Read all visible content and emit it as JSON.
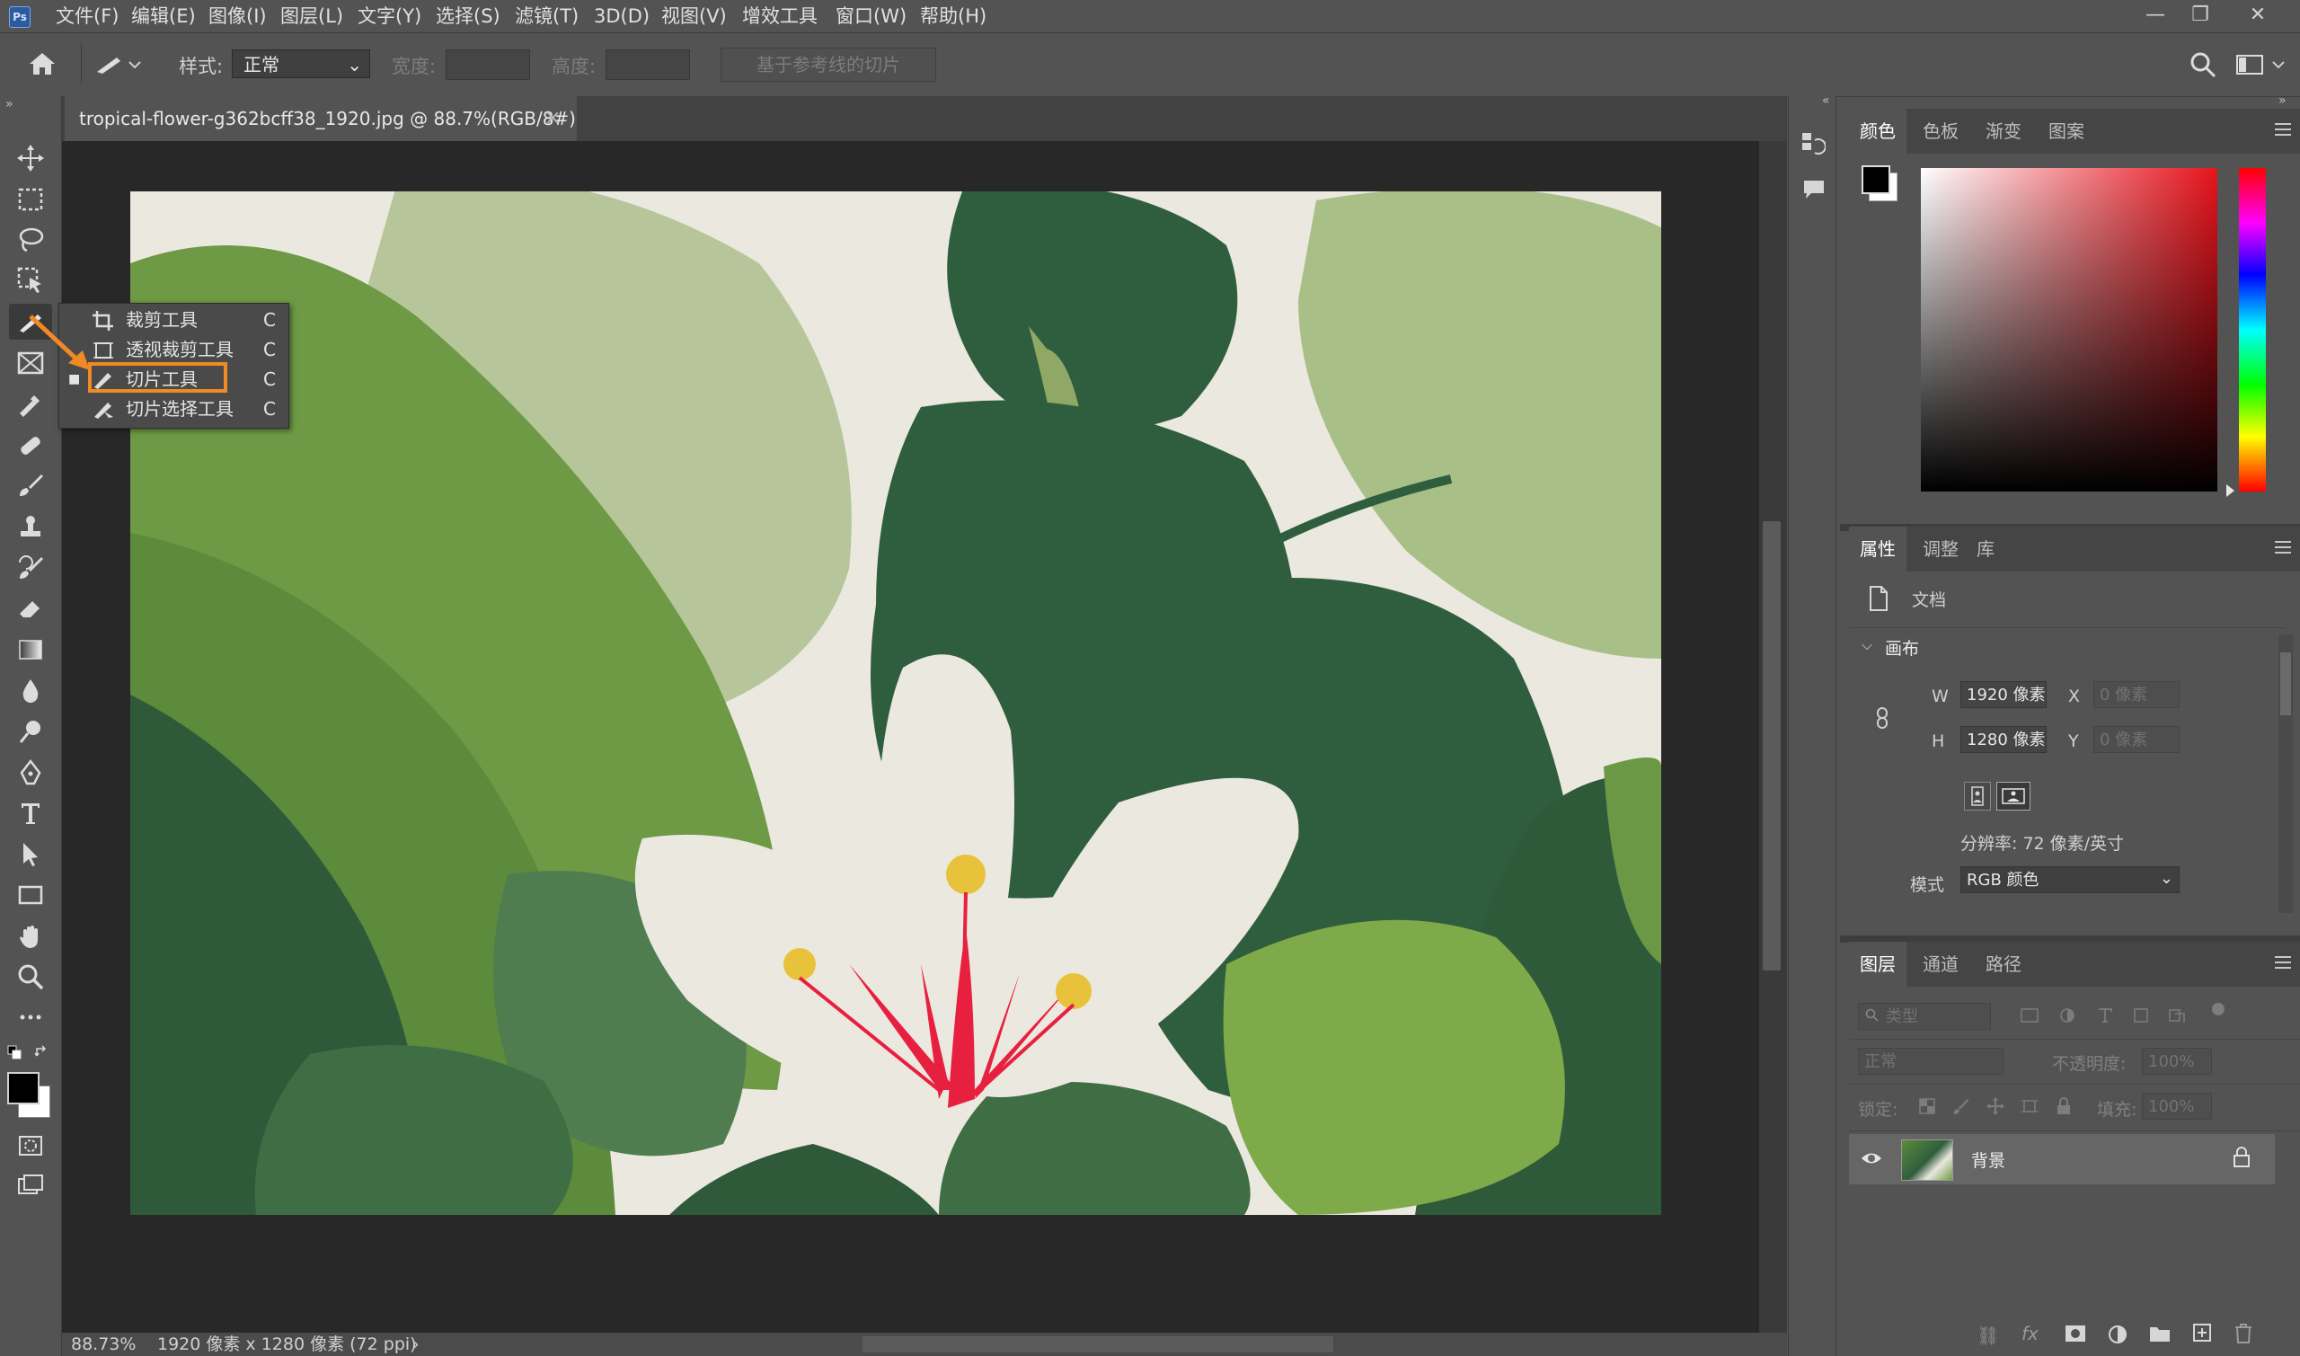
{
  "menubar": {
    "logo": "Ps",
    "items": [
      "文件(F)",
      "编辑(E)",
      "图像(I)",
      "图层(L)",
      "文字(Y)",
      "选择(S)",
      "滤镜(T)",
      "3D(D)",
      "视图(V)",
      "增效工具",
      "窗口(W)",
      "帮助(H)"
    ],
    "window_buttons": [
      "—",
      "❐",
      "✕"
    ]
  },
  "options": {
    "style_label": "样式:",
    "style_value": "正常",
    "width_label": "宽度:",
    "height_label": "高度:",
    "guides_button": "基于参考线的切片"
  },
  "document": {
    "tab_title": "tropical-flower-g362bcff38_1920.jpg @ 88.7%(RGB/8#)",
    "close_glyph": "×"
  },
  "status": {
    "zoom": "88.73%",
    "info": "1920 像素 x 1280 像素 (72 ppi)",
    "arrow": "›"
  },
  "flyout": {
    "items": [
      {
        "label": "裁剪工具",
        "key": "C",
        "icon": "crop-icon",
        "selected": false
      },
      {
        "label": "透视裁剪工具",
        "key": "C",
        "icon": "perspective-crop-icon",
        "selected": false
      },
      {
        "label": "切片工具",
        "key": "C",
        "icon": "slice-icon",
        "selected": true
      },
      {
        "label": "切片选择工具",
        "key": "C",
        "icon": "slice-select-icon",
        "selected": false
      }
    ]
  },
  "color_panel": {
    "tabs": [
      "颜色",
      "色板",
      "渐变",
      "图案"
    ],
    "active_tab": "颜色",
    "hue_color": "#e8131c"
  },
  "properties_panel": {
    "tabs": [
      "属性",
      "调整",
      "库"
    ],
    "active_tab": "属性",
    "doc_label": "文档",
    "section": "画布",
    "w_label": "W",
    "w_value": "1920 像素",
    "h_label": "H",
    "h_value": "1280 像素",
    "x_label": "X",
    "x_value": "0 像素",
    "y_label": "Y",
    "y_value": "0 像素",
    "resolution": "分辨率: 72 像素/英寸",
    "mode_label": "模式",
    "mode_value": "RGB 颜色"
  },
  "layers_panel": {
    "tabs": [
      "图层",
      "通道",
      "路径"
    ],
    "active_tab": "图层",
    "filter_placeholder": "类型",
    "blend_mode": "正常",
    "opacity_label": "不透明度:",
    "opacity_value": "100%",
    "lock_label": "锁定:",
    "fill_label": "填充:",
    "fill_value": "100%",
    "layers": [
      {
        "name": "背景",
        "visible": true,
        "locked": true
      }
    ]
  },
  "colors": {
    "accent_orange": "#f08a24",
    "foreground": "#000000",
    "background": "#ffffff"
  }
}
